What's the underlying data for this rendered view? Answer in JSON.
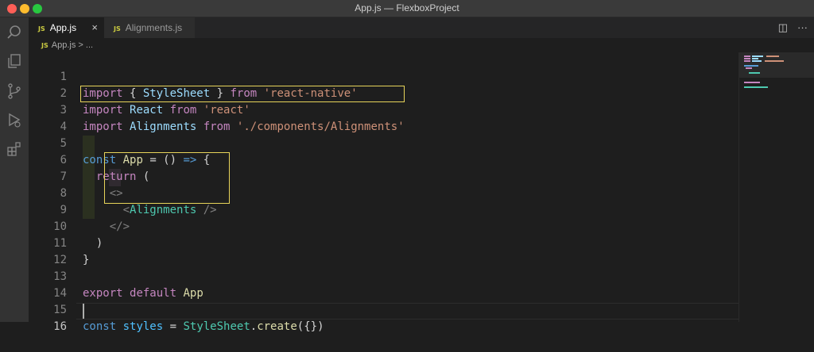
{
  "window": {
    "title": "App.js — FlexboxProject"
  },
  "activity_bar": {
    "items": [
      "search-icon",
      "explorer-icon",
      "source-control-icon",
      "run-debug-icon",
      "extensions-icon"
    ]
  },
  "tabs": [
    {
      "icon_text": "JS",
      "label": "App.js",
      "active": true,
      "close": "×"
    },
    {
      "icon_text": "JS",
      "label": "Alignments.js",
      "active": false
    }
  ],
  "tab_actions": {
    "split": "◫",
    "more": "···"
  },
  "breadcrumb": {
    "icon_text": "JS",
    "file": "App.js",
    "separator": ">",
    "rest": "..."
  },
  "editor": {
    "line_numbers": [
      "1",
      "2",
      "3",
      "4",
      "5",
      "6",
      "7",
      "8",
      "9",
      "10",
      "11",
      "12",
      "13",
      "14",
      "15",
      "16"
    ],
    "active_line": "16",
    "lines": {
      "l1": {
        "kw": "import",
        "a": " { ",
        "b": "StyleSheet",
        "c": " } ",
        "d": "from",
        "e": " ",
        "f": "'react-native'"
      },
      "l2": {
        "kw": "import",
        "a": " ",
        "b": "React",
        "c": " ",
        "d": "from",
        "e": " ",
        "f": "'react'"
      },
      "l3": {
        "kw": "import",
        "a": " ",
        "b": "Alignments",
        "c": " ",
        "d": "from",
        "e": " ",
        "f": "'./components/Alignments'"
      },
      "l5": {
        "kw": "const",
        "a": " ",
        "b": "App",
        "c": " = () ",
        "d": "=>",
        "e": " {"
      },
      "l6": {
        "indent": "  ",
        "kw": "return",
        "a": " ("
      },
      "l7": {
        "indent": "    ",
        "a": "<>"
      },
      "l8": {
        "indent": "      ",
        "a": "<",
        "b": "Alignments",
        "c": " />"
      },
      "l9": {
        "indent": "    ",
        "a": "</>"
      },
      "l10": {
        "indent": "  ",
        "a": ")"
      },
      "l11": {
        "a": "}"
      },
      "l13": {
        "kw": "export",
        "a": " ",
        "b": "default",
        "c": " ",
        "d": "App"
      },
      "l15": {
        "kw": "const",
        "a": " ",
        "b": "styles",
        "c": " = ",
        "d": "StyleSheet",
        "e": ".",
        "f": "create",
        "g": "({})"
      }
    }
  },
  "colors": {
    "highlight_box": "#e7d45a",
    "keyword": "#c586c0",
    "string": "#ce9178",
    "variable": "#9cdcfe",
    "tag": "#4ec9b0"
  }
}
